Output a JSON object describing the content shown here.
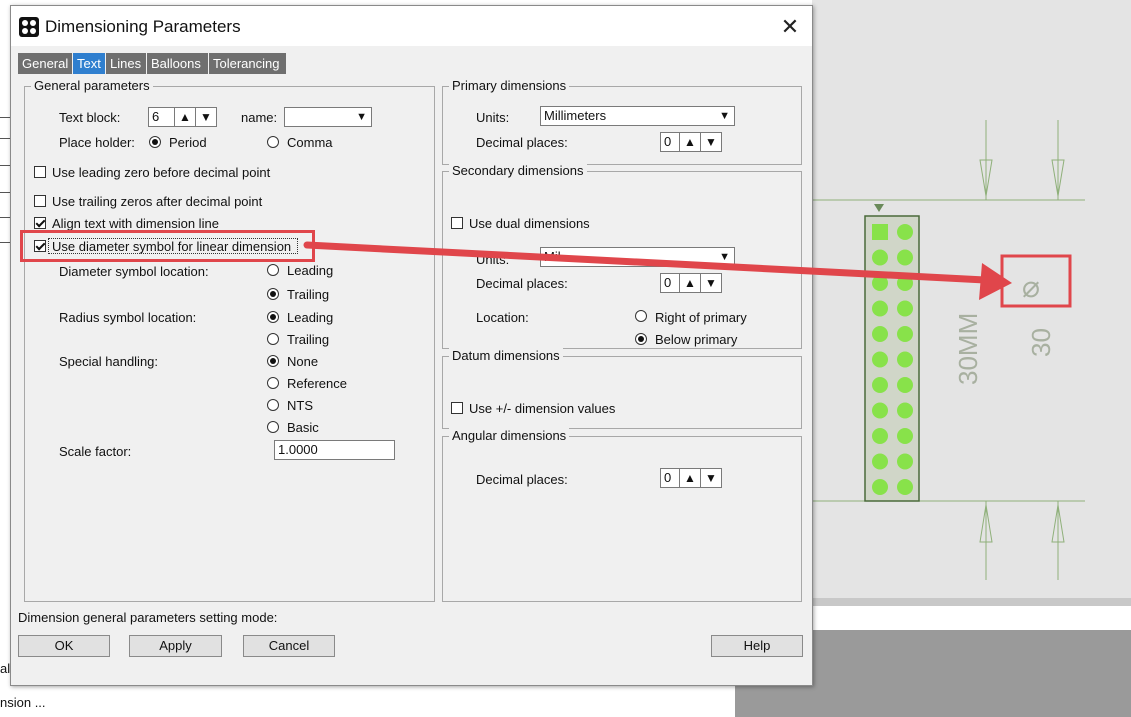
{
  "background": {
    "left_text_1": "alu",
    "left_text_2": "nsion ..."
  },
  "dialog": {
    "title": "Dimensioning Parameters",
    "close_glyph": "✕",
    "tabs": [
      "General",
      "Text",
      "Lines",
      "Balloons",
      "Tolerancing"
    ],
    "active_tab": "Text"
  },
  "general": {
    "title": "General parameters",
    "text_block_label": "Text block:",
    "text_block_value": "6",
    "name_label": "name:",
    "name_value": "",
    "place_holder_label": "Place holder:",
    "period": "Period",
    "comma": "Comma",
    "leading_zero": "Use leading zero before decimal point",
    "trailing_zeros": "Use trailing zeros after decimal point",
    "align_text": "Align text with dimension line",
    "diameter_symbol": "Use diameter symbol for linear dimension",
    "diameter_location_label": "Diameter symbol location:",
    "radius_location_label": "Radius symbol location:",
    "leading": "Leading",
    "trailing": "Trailing",
    "special_label": "Special handling:",
    "none": "None",
    "reference": "Reference",
    "nts": "NTS",
    "basic": "Basic",
    "scale_label": "Scale factor:",
    "scale_value": "1.0000"
  },
  "primary": {
    "title": "Primary dimensions",
    "units_label": "Units:",
    "units_value": "Millimeters",
    "decimal_label": "Decimal places:",
    "decimal_value": "0"
  },
  "secondary": {
    "title": "Secondary dimensions",
    "use_dual": "Use dual dimensions",
    "units_label": "Units:",
    "units_value": "Mil",
    "decimal_label": "Decimal places:",
    "decimal_value": "0",
    "location_label": "Location:",
    "right_of_primary": "Right of primary",
    "below_primary": "Below primary"
  },
  "datum": {
    "title": "Datum dimensions",
    "use_pm": "Use +/- dimension values"
  },
  "angular": {
    "title": "Angular dimensions",
    "decimal_label": "Decimal places:",
    "decimal_value": "0"
  },
  "footer": {
    "mode_text": "Dimension general parameters setting mode:",
    "ok": "OK",
    "apply": "Apply",
    "cancel": "Cancel",
    "help": "Help"
  },
  "canvas": {
    "dim_text_1": "30MM",
    "dim_text_2": "30",
    "diameter_glyph": "⌀"
  },
  "colors": {
    "tab_active": "#2f7fcf",
    "tab_inactive": "#6f6f6f",
    "annotation_red": "#e0464b",
    "pad_green": "#88e24a",
    "dim_line_green": "#8fb07a"
  }
}
